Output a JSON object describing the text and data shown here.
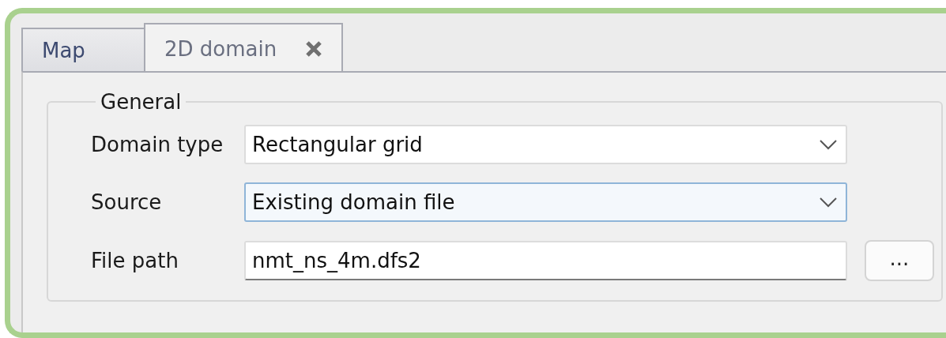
{
  "tabs": [
    {
      "label": "Map",
      "selected": false,
      "closable": false
    },
    {
      "label": "2D domain",
      "selected": true,
      "closable": true
    }
  ],
  "group": {
    "title": "General",
    "fields": [
      {
        "label": "Domain type",
        "kind": "dropdown",
        "value": "Rectangular grid",
        "focused": false
      },
      {
        "label": "Source",
        "kind": "dropdown",
        "value": "Existing domain file",
        "focused": true
      },
      {
        "label": "File path",
        "kind": "text",
        "value": "nmt_ns_4m.dfs2",
        "focused": false,
        "button": "..."
      }
    ]
  }
}
